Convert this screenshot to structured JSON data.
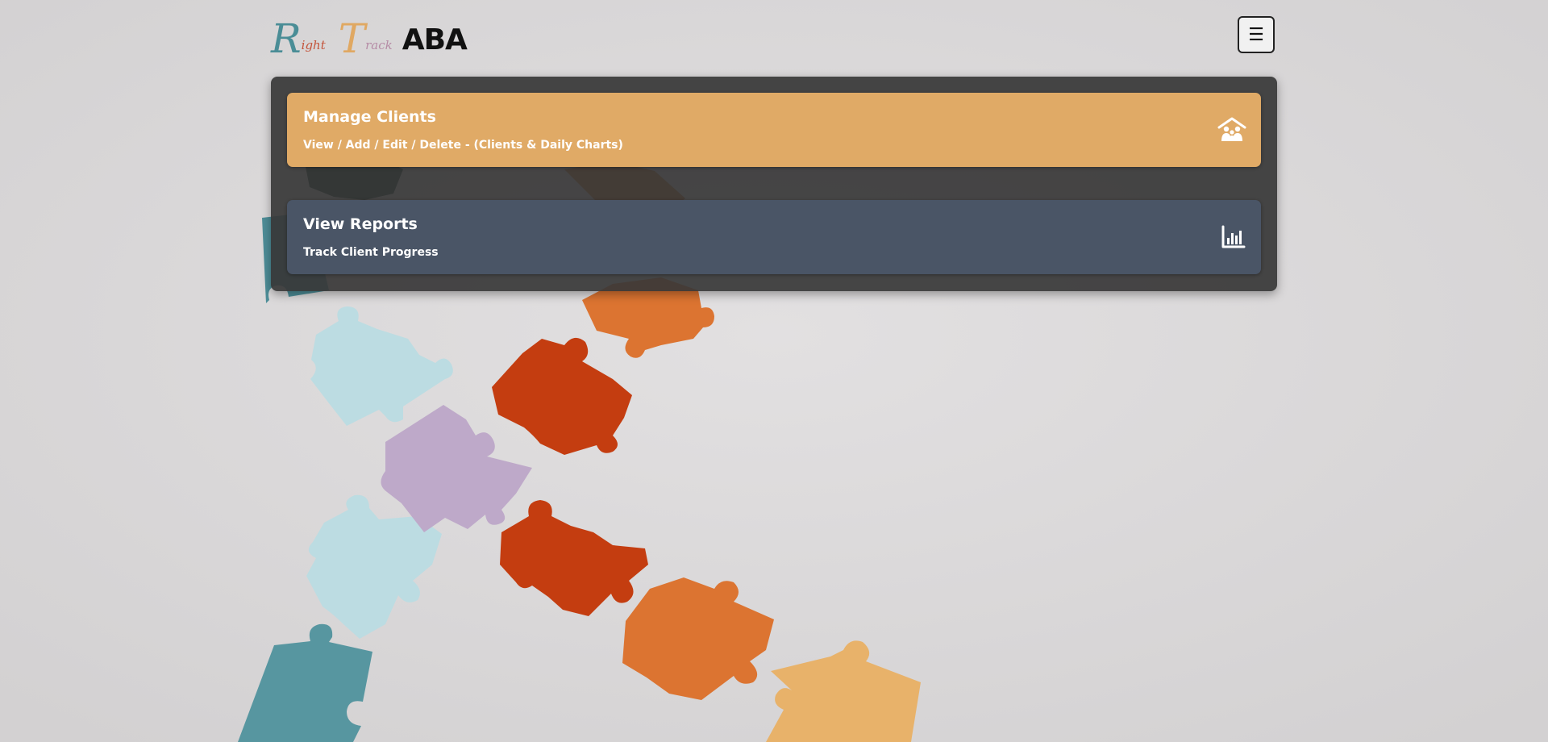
{
  "header": {
    "logo": {
      "r": "R",
      "ight": "ight",
      "t": "T",
      "rack": "rack",
      "aba": "ABA"
    },
    "menu_icon": "hamburger-icon",
    "menu_glyph": "☰"
  },
  "cards": {
    "manage": {
      "title": "Manage Clients",
      "subtitle": "View / Add / Edit / Delete - (Clients & Daily Charts)",
      "icon": "family-home-icon",
      "color": "#e0aa66"
    },
    "reports": {
      "title": "View Reports",
      "subtitle": "Track Client Progress",
      "icon": "bar-chart-icon",
      "color": "#4a5566"
    }
  }
}
